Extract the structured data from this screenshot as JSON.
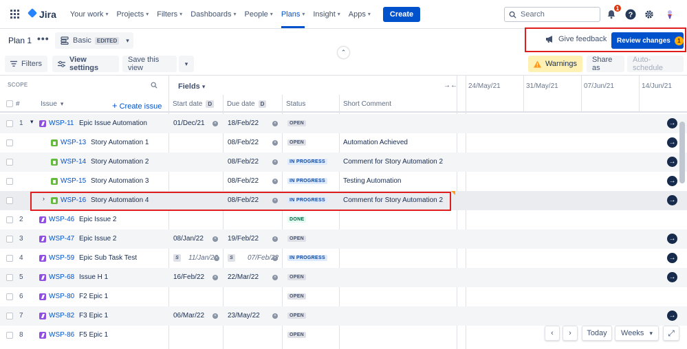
{
  "nav": {
    "logo": "Jira",
    "items": [
      {
        "label": "Your work"
      },
      {
        "label": "Projects"
      },
      {
        "label": "Filters"
      },
      {
        "label": "Dashboards"
      },
      {
        "label": "People"
      },
      {
        "label": "Plans"
      },
      {
        "label": "Insight"
      },
      {
        "label": "Apps"
      }
    ],
    "active": "Plans",
    "create_label": "Create",
    "search_placeholder": "Search",
    "notification_count": "1"
  },
  "plan": {
    "title": "Plan 1",
    "view_name": "Basic",
    "view_state": "EDITED",
    "feedback_label": "Give feedback",
    "review_label": "Review changes",
    "review_count": "1"
  },
  "toolbar": {
    "filters": "Filters",
    "view_settings": "View settings",
    "save_view": "Save this view",
    "warnings": "Warnings",
    "share": "Share as",
    "auto_schedule": "Auto-schedule"
  },
  "table": {
    "scope_label": "SCOPE",
    "fields_label": "Fields",
    "headers": {
      "num": "#",
      "issue": "Issue",
      "create_issue": "Create issue",
      "start_date": "Start date",
      "due_date": "Due date",
      "date_badge": "D",
      "status": "Status",
      "comment": "Short Comment"
    },
    "timeline_dates": [
      "24/May/21",
      "31/May/21",
      "07/Jun/21",
      "14/Jun/21"
    ],
    "rows": [
      {
        "num": "1",
        "type": "epic",
        "key": "WSP-11",
        "summary": "Epic Issue Automation",
        "start": "01/Dec/21",
        "due": "18/Feb/22",
        "status": "OPEN",
        "comment": ""
      },
      {
        "num": "",
        "type": "story",
        "key": "WSP-13",
        "summary": "Story Automation 1",
        "start": "",
        "due": "08/Feb/22",
        "status": "OPEN",
        "comment": "Automation Achieved"
      },
      {
        "num": "",
        "type": "story",
        "key": "WSP-14",
        "summary": "Story Automation 2",
        "start": "",
        "due": "08/Feb/22",
        "status": "IN PROGRESS",
        "comment": "Comment for Story Automation 2"
      },
      {
        "num": "",
        "type": "story",
        "key": "WSP-15",
        "summary": "Story Automation 3",
        "start": "",
        "due": "08/Feb/22",
        "status": "IN PROGRESS",
        "comment": "Testing Automation"
      },
      {
        "num": "",
        "type": "story",
        "key": "WSP-16",
        "summary": "Story Automation 4",
        "start": "",
        "due": "08/Feb/22",
        "status": "IN PROGRESS",
        "comment": "Comment for Story Automation 2"
      },
      {
        "num": "2",
        "type": "epic",
        "key": "WSP-46",
        "summary": "Epic Issue 2",
        "start": "",
        "due": "",
        "status": "DONE",
        "comment": ""
      },
      {
        "num": "3",
        "type": "epic",
        "key": "WSP-47",
        "summary": "Epic Issue 2",
        "start": "08/Jan/22",
        "due": "19/Feb/22",
        "status": "OPEN",
        "comment": ""
      },
      {
        "num": "4",
        "type": "epic",
        "key": "WSP-59",
        "summary": "Epic Sub Task Test",
        "start": "11/Jan/22",
        "due": "07/Feb/22",
        "status": "IN PROGRESS",
        "comment": ""
      },
      {
        "num": "5",
        "type": "epic",
        "key": "WSP-68",
        "summary": "Issue H 1",
        "start": "16/Feb/22",
        "due": "22/Mar/22",
        "status": "OPEN",
        "comment": ""
      },
      {
        "num": "6",
        "type": "epic",
        "key": "WSP-80",
        "summary": "F2 Epic 1",
        "start": "",
        "due": "",
        "status": "OPEN",
        "comment": ""
      },
      {
        "num": "7",
        "type": "epic",
        "key": "WSP-82",
        "summary": "F3 Epic 1",
        "start": "06/Mar/22",
        "due": "23/May/22",
        "status": "OPEN",
        "comment": ""
      },
      {
        "num": "8",
        "type": "epic",
        "key": "WSP-86",
        "summary": "F5 Epic 1",
        "start": "",
        "due": "",
        "status": "OPEN",
        "comment": ""
      }
    ],
    "sprint_marker": "S"
  },
  "controls": {
    "today": "Today",
    "weeks": "Weeks"
  },
  "icons": [
    "app-switcher-icon",
    "search-icon",
    "notification-icon",
    "help-icon",
    "settings-icon",
    "avatar",
    "megaphone-icon",
    "filter-icon",
    "settings-sliders-icon",
    "chevron-down-icon",
    "arrow-right-icon",
    "close-icon",
    "expand-icon"
  ],
  "colors": {
    "primary": "#0052cc",
    "epic": "#904ee2",
    "story": "#63ba3c",
    "warning": "#fff0b3",
    "highlight": "#e01d1d"
  }
}
